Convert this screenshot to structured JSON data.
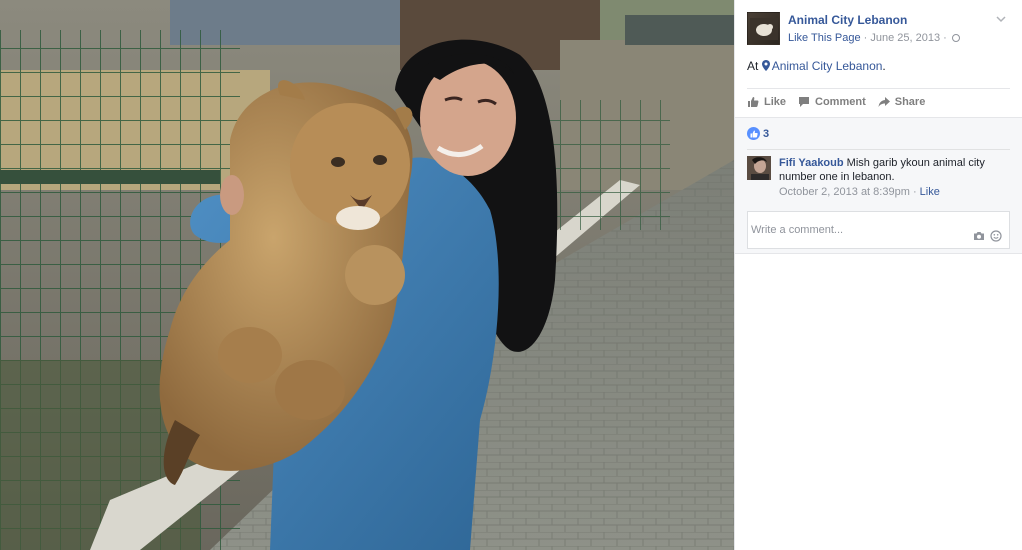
{
  "photo": {
    "description_icon": "photo-of-woman-holding-lion-cub"
  },
  "post": {
    "page_name": "Animal City Lebanon",
    "like_page_label": "Like This Page",
    "separator": "·",
    "date": "June 25, 2013",
    "privacy_icon": "globe-icon",
    "location_prefix": "At",
    "location_name": "Animal City Lebanon",
    "location_suffix": ".",
    "options_icon": "chevron-down-icon"
  },
  "actions": {
    "like_label": "Like",
    "comment_label": "Comment",
    "share_label": "Share"
  },
  "reactions": {
    "count": "3",
    "icon": "thumbs-up-icon"
  },
  "comments": [
    {
      "author": "Fifi Yaakoub",
      "text": "Mish garib ykoun animal city number one in lebanon.",
      "timestamp": "October 2, 2013 at 8:39pm",
      "separator": "·",
      "like_label": "Like"
    }
  ],
  "comment_box": {
    "placeholder": "Write a comment...",
    "camera_icon": "camera-icon",
    "emoji_icon": "emoji-icon"
  },
  "colors": {
    "link": "#365899",
    "muted": "#90949c",
    "like_blue": "#5890ff",
    "panel_bg": "#f6f7f9"
  }
}
